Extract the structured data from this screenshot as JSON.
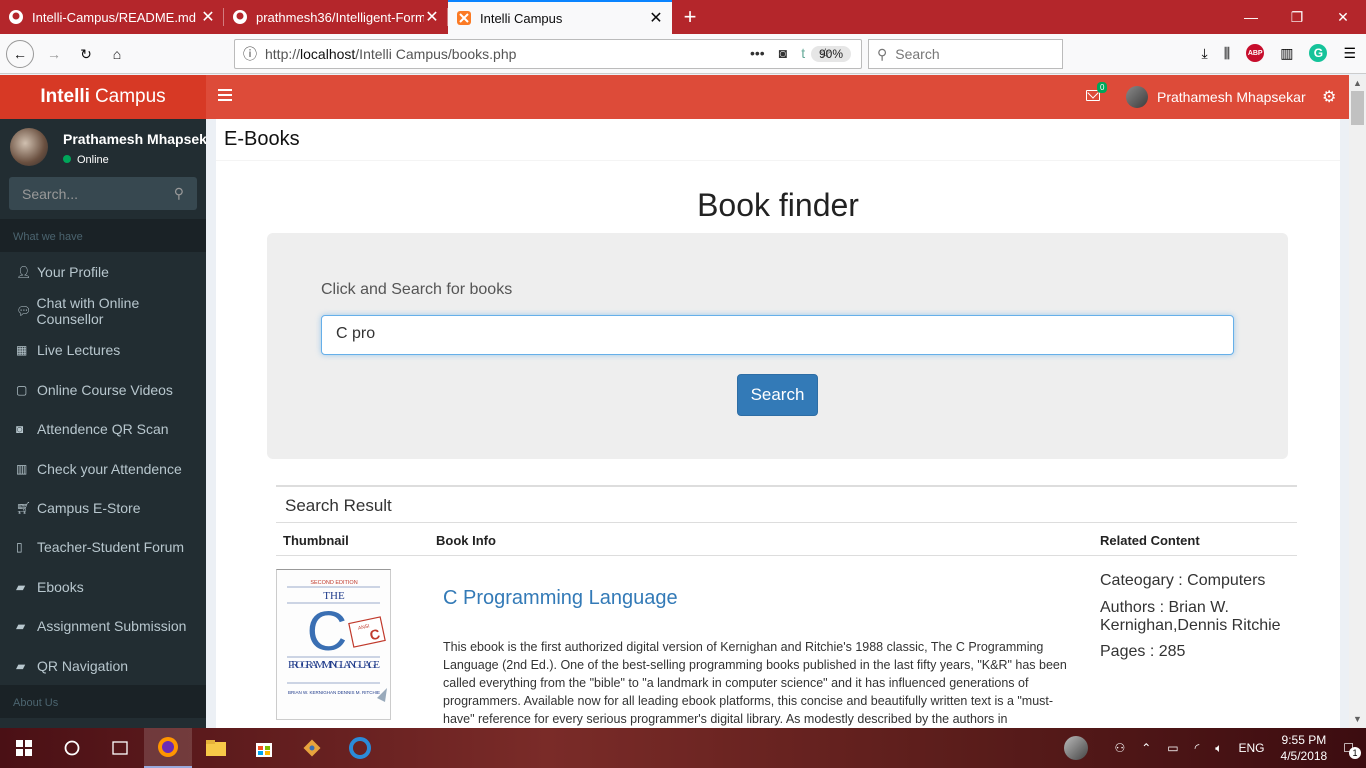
{
  "browser": {
    "tabs": [
      {
        "title": "Intelli-Campus/README.md at",
        "active": false
      },
      {
        "title": "prathmesh36/Intelligent-Form",
        "active": false
      },
      {
        "title": "Intelli Campus",
        "active": true
      }
    ],
    "url_prefix": "http://",
    "url_host": "localhost",
    "url_path": "/Intelli Campus/books.php",
    "zoom": "90%",
    "search_placeholder": "Search"
  },
  "app": {
    "logo_bold": "Intelli",
    "logo_rest": "Campus",
    "mail_count": "0",
    "user_name": "Prathamesh Mhapsekar"
  },
  "sidebar": {
    "profile_name": "Prathamesh Mhapsekar",
    "status": "Online",
    "search_placeholder": "Search...",
    "section_header": "What we have",
    "items": [
      {
        "label": "Your Profile",
        "icon": "user-icon"
      },
      {
        "label": "Chat with Online Counsellor",
        "icon": "chat-icon"
      },
      {
        "label": "Live Lectures",
        "icon": "calendar-icon"
      },
      {
        "label": "Online Course Videos",
        "icon": "video-icon"
      },
      {
        "label": "Attendence QR Scan",
        "icon": "camera-icon"
      },
      {
        "label": "Check your Attendence",
        "icon": "bar-chart-icon"
      },
      {
        "label": "Campus E-Store",
        "icon": "cart-icon"
      },
      {
        "label": "Teacher-Student Forum",
        "icon": "forum-icon"
      },
      {
        "label": "Ebooks",
        "icon": "book-icon"
      },
      {
        "label": "Assignment Submission",
        "icon": "book-icon"
      },
      {
        "label": "QR Navigation",
        "icon": "book-icon"
      }
    ],
    "section_header_2": "About Us"
  },
  "main": {
    "page_header": "E-Books",
    "title": "Book finder",
    "search_label": "Click and Search for books",
    "search_value": "C pro",
    "search_button": "Search",
    "results_title": "Search Result",
    "columns": [
      "Thumbnail",
      "Book Info",
      "Related Content"
    ],
    "book": {
      "title": "C Programming Language",
      "description": "This ebook is the first authorized digital version of Kernighan and Ritchie's 1988 classic, The C Programming Language (2nd Ed.). One of the best-selling programming books published in the last fifty years, \"K&R\" has been called everything from the \"bible\" to \"a landmark in computer science\" and it has influenced generations of programmers. Available now for all leading ebook platforms, this concise and beautifully written text is a \"must-have\" reference for every serious programmer's digital library. As modestly described by the authors in",
      "category": "Cateogary : Computers",
      "authors": "Authors : Brian W. Kernighan,Dennis Ritchie",
      "pages": "Pages : 285",
      "cover_edition": "SECOND EDITION",
      "cover_the": "THE",
      "cover_c": "C",
      "cover_title": "PROGRAMMING LANGUAGE",
      "cover_authors": "BRIAN W. KERNIGHAN DENNIS M. RITCHIE",
      "cover_ansi": "ANSI"
    }
  },
  "taskbar": {
    "language": "ENG",
    "time": "9:55 PM",
    "date": "4/5/2018",
    "notification_count": "1"
  }
}
